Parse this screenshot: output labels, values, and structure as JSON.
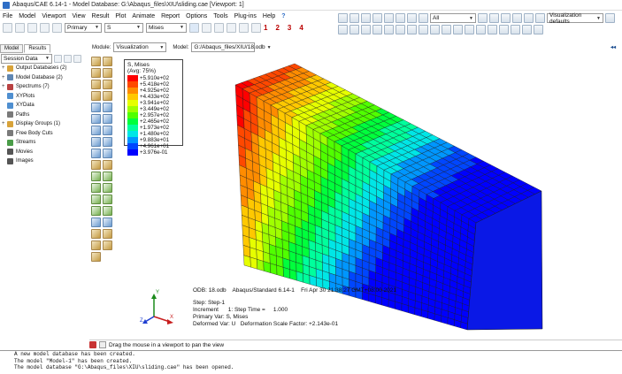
{
  "window": {
    "title": "Abaqus/CAE 6.14-1 - Model Database: G:\\Abaqus_files\\XIU\\sliding.cae [Viewport: 1]"
  },
  "menu": {
    "items": [
      "File",
      "Model",
      "Viewport",
      "View",
      "Result",
      "Plot",
      "Animate",
      "Report",
      "Options",
      "Tools",
      "Plug-ins",
      "Help"
    ],
    "help_icon": "?",
    "quick_numbers": [
      "1",
      "2",
      "3",
      "4"
    ]
  },
  "toolbar": {
    "primary_select": "Primary",
    "variable_select": "S",
    "component_select": "Mises",
    "filter_value": "All",
    "visualization_defaults": "Visualization defaults"
  },
  "left_panel": {
    "tabs": [
      "Model",
      "Results"
    ],
    "session_select": "Session Data",
    "tree": [
      {
        "label": "Output Databases (2)",
        "expander": "+",
        "indent": 0,
        "color": "#d8a33a"
      },
      {
        "label": "Model Database (2)",
        "expander": "+",
        "indent": 0,
        "color": "#5f86b2"
      },
      {
        "label": "Spectrums (7)",
        "expander": "+",
        "indent": 0,
        "color": "#b94242"
      },
      {
        "label": "XYPlots",
        "expander": "",
        "indent": 1,
        "color": "#4f8fd0"
      },
      {
        "label": "XYData",
        "expander": "",
        "indent": 1,
        "color": "#4f8fd0"
      },
      {
        "label": "Paths",
        "expander": "",
        "indent": 1,
        "color": "#7a7a7a"
      },
      {
        "label": "Display Groups (1)",
        "expander": "+",
        "indent": 0,
        "color": "#d8a33a"
      },
      {
        "label": "Free Body Cuts",
        "expander": "",
        "indent": 1,
        "color": "#7a7a7a"
      },
      {
        "label": "Streams",
        "expander": "",
        "indent": 1,
        "color": "#4a9c48"
      },
      {
        "label": "Movies",
        "expander": "",
        "indent": 1,
        "color": "#555"
      },
      {
        "label": "Images",
        "expander": "",
        "indent": 1,
        "color": "#555"
      }
    ]
  },
  "module_bar": {
    "module_label": "Module:",
    "module_value": "Visualization",
    "model_label": "Model:",
    "model_value": "G:/Abaqus_files/XIU/18.odb"
  },
  "legend": {
    "title": "S, Mises",
    "avg": "(Avg: 75%)",
    "entries": [
      {
        "value": "+5.910e+02",
        "color": "#ff0000"
      },
      {
        "value": "+5.418e+02",
        "color": "#ff4800"
      },
      {
        "value": "+4.925e+02",
        "color": "#ff8c00"
      },
      {
        "value": "+4.433e+02",
        "color": "#ffc800"
      },
      {
        "value": "+3.941e+02",
        "color": "#e6ff00"
      },
      {
        "value": "+3.449e+02",
        "color": "#a0ff00"
      },
      {
        "value": "+2.957e+02",
        "color": "#50ff00"
      },
      {
        "value": "+2.465e+02",
        "color": "#00ff3c"
      },
      {
        "value": "+1.973e+02",
        "color": "#00ff9c"
      },
      {
        "value": "+1.480e+02",
        "color": "#00e6e6"
      },
      {
        "value": "+9.883e+01",
        "color": "#0096ff"
      },
      {
        "value": "+4.961e+01",
        "color": "#0046ff"
      },
      {
        "value": "+3.976e-01",
        "color": "#0000ff"
      }
    ]
  },
  "viewport_info": {
    "odb_line": "ODB: 18.odb    Abaqus/Standard 6.14-1    Fri Apr 30 21:38:27 GMT+08:00 2021",
    "step_line": "Step: Step-1",
    "increment_line": "Increment      1: Step Time =     1.000",
    "primary_line": "Primary Var: S, Mises",
    "deformed_line": "Deformed Var: U   Deformation Scale Factor: +2.143e-01"
  },
  "triad": {
    "x": "X",
    "y": "Y",
    "z": "Z"
  },
  "prompt": {
    "text": "Drag the mouse in a viewport to pan the view"
  },
  "messages": [
    "A new model database has been created.",
    "The model \"Model-1\" has been created.",
    "The model database \"G:\\Abaqus_files\\XIU\\sliding.cae\" has been opened."
  ]
}
